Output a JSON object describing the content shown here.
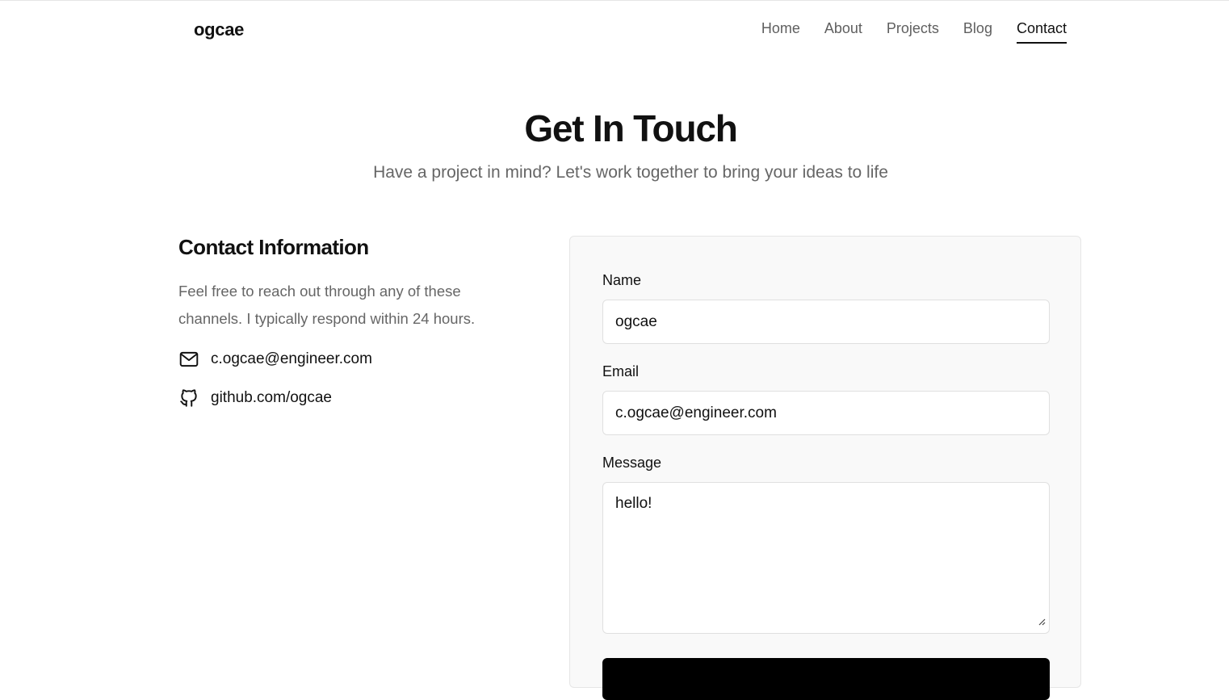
{
  "header": {
    "logo": "ogcae",
    "nav": [
      {
        "label": "Home",
        "active": false
      },
      {
        "label": "About",
        "active": false
      },
      {
        "label": "Projects",
        "active": false
      },
      {
        "label": "Blog",
        "active": false
      },
      {
        "label": "Contact",
        "active": true
      }
    ]
  },
  "hero": {
    "title": "Get In Touch",
    "subtitle": "Have a project in mind? Let's work together to bring your ideas to life"
  },
  "contact_info": {
    "heading": "Contact Information",
    "description": "Feel free to reach out through any of these channels. I typically respond within 24 hours.",
    "items": [
      {
        "icon": "mail-icon",
        "text": "c.ogcae@engineer.com"
      },
      {
        "icon": "github-icon",
        "text": "github.com/ogcae"
      }
    ]
  },
  "form": {
    "name_label": "Name",
    "name_value": "ogcae",
    "email_label": "Email",
    "email_value": "c.ogcae@engineer.com",
    "message_label": "Message",
    "message_value": "hello!"
  },
  "colors": {
    "accent": "#000000",
    "muted_text": "#666666",
    "card_background": "#f9f9f9",
    "border": "#e0e0e0"
  }
}
